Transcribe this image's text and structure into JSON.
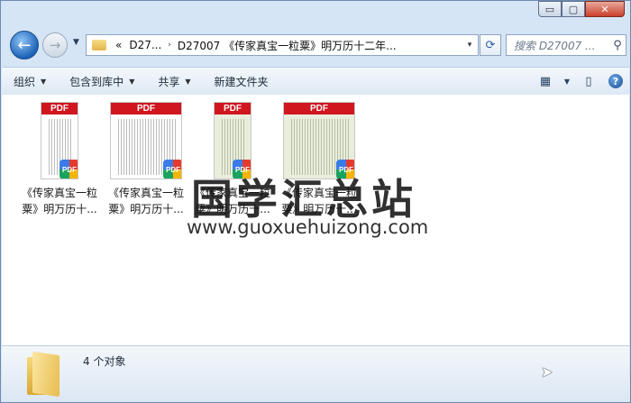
{
  "window": {
    "caption_buttons": {
      "minimize": "▭",
      "maximize": "▢",
      "close": "✕"
    }
  },
  "address_bar": {
    "history_marker": "«",
    "segments": [
      "D27...",
      "D27007 《传家真宝一粒粟》明万历十二年..."
    ],
    "separator": "›",
    "dropdown_icon": "▾"
  },
  "search": {
    "placeholder": "搜索 D27007 ..."
  },
  "toolbar": {
    "organize": "组织",
    "include_library": "包含到库中",
    "share": "共享",
    "new_folder": "新建文件夹"
  },
  "files": [
    {
      "name_line1": "《传家真宝一粒",
      "name_line2": "粟》明万历十...",
      "thumb_label": "PDF",
      "badge": "PDF",
      "tinted": false
    },
    {
      "name_line1": "《传家真宝一粒",
      "name_line2": "粟》明万历十...",
      "thumb_label": "PDF",
      "badge": "PDF",
      "tinted": false
    },
    {
      "name_line1": "《传家真宝一粒",
      "name_line2": "粟》明万历十...",
      "thumb_label": "PDF",
      "badge": "PDF",
      "tinted": true
    },
    {
      "name_line1": "《传家真宝一粒",
      "name_line2": "粟》明万历十...",
      "thumb_label": "PDF",
      "badge": "PDF",
      "tinted": true
    }
  ],
  "watermark": {
    "title": "国学汇总站",
    "url": "www.guoxuehuizong.com"
  },
  "status": {
    "count_text": "4 个对象"
  }
}
